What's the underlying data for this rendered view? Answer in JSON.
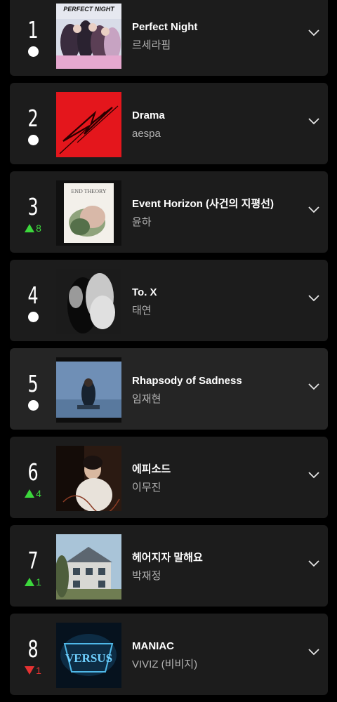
{
  "colors": {
    "background": "#000000",
    "card": "#1c1c1c",
    "card_highlight": "#252525",
    "up": "#3cd73c",
    "down": "#e63232",
    "artist_text": "#b3b3b3"
  },
  "chart": [
    {
      "rank": "1",
      "change": "same",
      "change_value": "",
      "title": "Perfect Night",
      "artist": "르세라핌",
      "cover_text": "PERFECT NIGHT"
    },
    {
      "rank": "2",
      "change": "same",
      "change_value": "",
      "title": "Drama",
      "artist": "aespa",
      "cover_text": ""
    },
    {
      "rank": "3",
      "change": "up",
      "change_value": "8",
      "title": "Event Horizon (사건의 지평선)",
      "artist": "윤하",
      "cover_text": "END THEORY"
    },
    {
      "rank": "4",
      "change": "same",
      "change_value": "",
      "title": "To. X",
      "artist": "태연",
      "cover_text": ""
    },
    {
      "rank": "5",
      "change": "same",
      "change_value": "",
      "title": "Rhapsody of Sadness",
      "artist": "임재현",
      "cover_text": ""
    },
    {
      "rank": "6",
      "change": "up",
      "change_value": "4",
      "title": "에피소드",
      "artist": "이무진",
      "cover_text": ""
    },
    {
      "rank": "7",
      "change": "up",
      "change_value": "1",
      "title": "헤어지자 말해요",
      "artist": "박재정",
      "cover_text": ""
    },
    {
      "rank": "8",
      "change": "down",
      "change_value": "1",
      "title": "MANIAC",
      "artist": "VIVIZ (비비지)",
      "cover_text": "VERSUS"
    }
  ],
  "icons": {
    "expand": "chevron-down-icon",
    "no_change": "circle-dot-icon",
    "rank_up": "triangle-up-icon",
    "rank_down": "triangle-down-icon"
  }
}
